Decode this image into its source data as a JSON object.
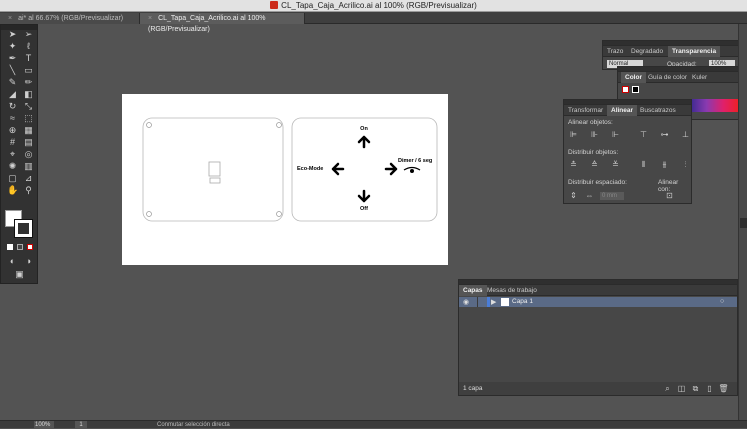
{
  "window": {
    "title": "CL_Tapa_Caja_Acrilico.ai al 100% (RGB/Previsualizar)"
  },
  "tabs": [
    {
      "label": "ai* al 66.67% (RGB/Previsualizar)"
    },
    {
      "label": "CL_Tapa_Caja_Acrilico.ai al 100% (RGB/Previsualizar)"
    }
  ],
  "artboard": {
    "labels": {
      "on": "On",
      "eco_mode": "Eco-Mode",
      "dimmer": "Dimer / 6 seg",
      "off": "Off"
    }
  },
  "transparency_panel": {
    "tabs": [
      "Trazo",
      "Degradado",
      "Transparencia"
    ],
    "blend_mode": "Normal",
    "opacity_label": "Opacidad:",
    "opacity_value": "100%"
  },
  "color_panel": {
    "tabs": [
      "Color",
      "Guía de color",
      "Kuler"
    ]
  },
  "align_panel": {
    "tabs": [
      "Transformar",
      "Alinear",
      "Buscatrazos"
    ],
    "align_objects": "Alinear objetos:",
    "distribute_objects": "Distribuir objetos:",
    "distribute_spacing": "Distribuir espaciado:",
    "align_to": "Alinear con:",
    "spacing_value": "0 mm"
  },
  "layers_panel": {
    "tabs": [
      "Capas",
      "Mesas de trabajo"
    ],
    "layer_name": "Capa 1",
    "footer": "1 capa"
  },
  "statusbar": {
    "zoom": "100%",
    "page": "1",
    "tool_hint": "Conmutar selección directa"
  },
  "colors": {
    "app_bg": "#535353",
    "panel": "#474747",
    "selection": "#5a6a86",
    "ai_icon": "#cc2b1b"
  }
}
